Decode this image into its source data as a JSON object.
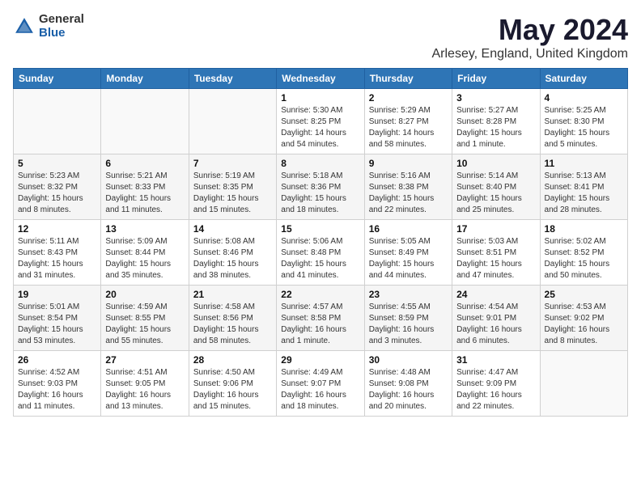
{
  "logo": {
    "general": "General",
    "blue": "Blue"
  },
  "title": {
    "month_year": "May 2024",
    "location": "Arlesey, England, United Kingdom"
  },
  "headers": [
    "Sunday",
    "Monday",
    "Tuesday",
    "Wednesday",
    "Thursday",
    "Friday",
    "Saturday"
  ],
  "weeks": [
    [
      {
        "day": "",
        "info": ""
      },
      {
        "day": "",
        "info": ""
      },
      {
        "day": "",
        "info": ""
      },
      {
        "day": "1",
        "info": "Sunrise: 5:30 AM\nSunset: 8:25 PM\nDaylight: 14 hours\nand 54 minutes."
      },
      {
        "day": "2",
        "info": "Sunrise: 5:29 AM\nSunset: 8:27 PM\nDaylight: 14 hours\nand 58 minutes."
      },
      {
        "day": "3",
        "info": "Sunrise: 5:27 AM\nSunset: 8:28 PM\nDaylight: 15 hours\nand 1 minute."
      },
      {
        "day": "4",
        "info": "Sunrise: 5:25 AM\nSunset: 8:30 PM\nDaylight: 15 hours\nand 5 minutes."
      }
    ],
    [
      {
        "day": "5",
        "info": "Sunrise: 5:23 AM\nSunset: 8:32 PM\nDaylight: 15 hours\nand 8 minutes."
      },
      {
        "day": "6",
        "info": "Sunrise: 5:21 AM\nSunset: 8:33 PM\nDaylight: 15 hours\nand 11 minutes."
      },
      {
        "day": "7",
        "info": "Sunrise: 5:19 AM\nSunset: 8:35 PM\nDaylight: 15 hours\nand 15 minutes."
      },
      {
        "day": "8",
        "info": "Sunrise: 5:18 AM\nSunset: 8:36 PM\nDaylight: 15 hours\nand 18 minutes."
      },
      {
        "day": "9",
        "info": "Sunrise: 5:16 AM\nSunset: 8:38 PM\nDaylight: 15 hours\nand 22 minutes."
      },
      {
        "day": "10",
        "info": "Sunrise: 5:14 AM\nSunset: 8:40 PM\nDaylight: 15 hours\nand 25 minutes."
      },
      {
        "day": "11",
        "info": "Sunrise: 5:13 AM\nSunset: 8:41 PM\nDaylight: 15 hours\nand 28 minutes."
      }
    ],
    [
      {
        "day": "12",
        "info": "Sunrise: 5:11 AM\nSunset: 8:43 PM\nDaylight: 15 hours\nand 31 minutes."
      },
      {
        "day": "13",
        "info": "Sunrise: 5:09 AM\nSunset: 8:44 PM\nDaylight: 15 hours\nand 35 minutes."
      },
      {
        "day": "14",
        "info": "Sunrise: 5:08 AM\nSunset: 8:46 PM\nDaylight: 15 hours\nand 38 minutes."
      },
      {
        "day": "15",
        "info": "Sunrise: 5:06 AM\nSunset: 8:48 PM\nDaylight: 15 hours\nand 41 minutes."
      },
      {
        "day": "16",
        "info": "Sunrise: 5:05 AM\nSunset: 8:49 PM\nDaylight: 15 hours\nand 44 minutes."
      },
      {
        "day": "17",
        "info": "Sunrise: 5:03 AM\nSunset: 8:51 PM\nDaylight: 15 hours\nand 47 minutes."
      },
      {
        "day": "18",
        "info": "Sunrise: 5:02 AM\nSunset: 8:52 PM\nDaylight: 15 hours\nand 50 minutes."
      }
    ],
    [
      {
        "day": "19",
        "info": "Sunrise: 5:01 AM\nSunset: 8:54 PM\nDaylight: 15 hours\nand 53 minutes."
      },
      {
        "day": "20",
        "info": "Sunrise: 4:59 AM\nSunset: 8:55 PM\nDaylight: 15 hours\nand 55 minutes."
      },
      {
        "day": "21",
        "info": "Sunrise: 4:58 AM\nSunset: 8:56 PM\nDaylight: 15 hours\nand 58 minutes."
      },
      {
        "day": "22",
        "info": "Sunrise: 4:57 AM\nSunset: 8:58 PM\nDaylight: 16 hours\nand 1 minute."
      },
      {
        "day": "23",
        "info": "Sunrise: 4:55 AM\nSunset: 8:59 PM\nDaylight: 16 hours\nand 3 minutes."
      },
      {
        "day": "24",
        "info": "Sunrise: 4:54 AM\nSunset: 9:01 PM\nDaylight: 16 hours\nand 6 minutes."
      },
      {
        "day": "25",
        "info": "Sunrise: 4:53 AM\nSunset: 9:02 PM\nDaylight: 16 hours\nand 8 minutes."
      }
    ],
    [
      {
        "day": "26",
        "info": "Sunrise: 4:52 AM\nSunset: 9:03 PM\nDaylight: 16 hours\nand 11 minutes."
      },
      {
        "day": "27",
        "info": "Sunrise: 4:51 AM\nSunset: 9:05 PM\nDaylight: 16 hours\nand 13 minutes."
      },
      {
        "day": "28",
        "info": "Sunrise: 4:50 AM\nSunset: 9:06 PM\nDaylight: 16 hours\nand 15 minutes."
      },
      {
        "day": "29",
        "info": "Sunrise: 4:49 AM\nSunset: 9:07 PM\nDaylight: 16 hours\nand 18 minutes."
      },
      {
        "day": "30",
        "info": "Sunrise: 4:48 AM\nSunset: 9:08 PM\nDaylight: 16 hours\nand 20 minutes."
      },
      {
        "day": "31",
        "info": "Sunrise: 4:47 AM\nSunset: 9:09 PM\nDaylight: 16 hours\nand 22 minutes."
      },
      {
        "day": "",
        "info": ""
      }
    ]
  ]
}
